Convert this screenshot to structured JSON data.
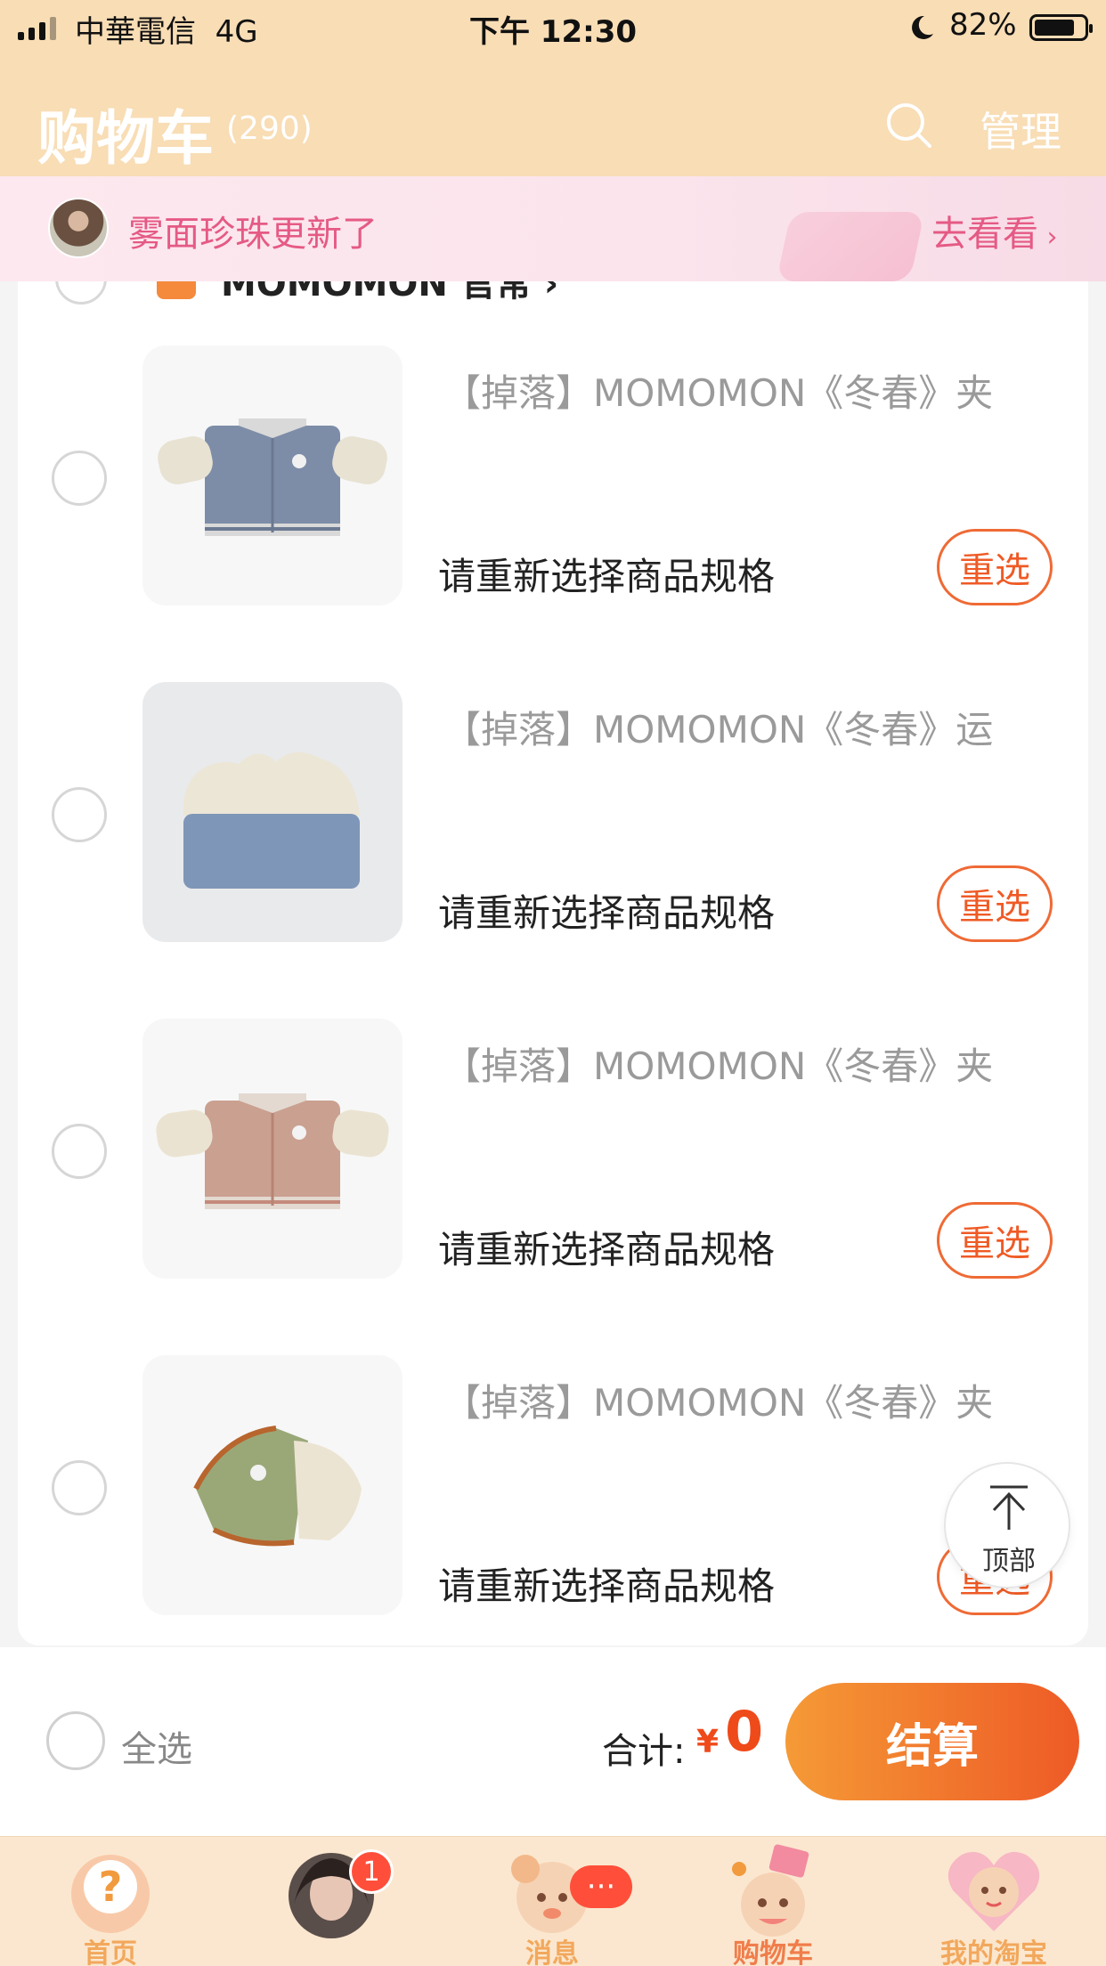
{
  "status_bar": {
    "carrier": "中華電信",
    "network": "4G",
    "time": "下午 12:30",
    "battery_pct": "82%",
    "battery_level": 0.82
  },
  "header": {
    "title": "购物车",
    "count": "(290)",
    "manage_label": "管理",
    "search_icon": "search-icon"
  },
  "banner": {
    "text": "雾面珍珠更新了",
    "link": "去看看"
  },
  "shop_peek": {
    "name": "MOMOMON 官常 ›"
  },
  "items": [
    {
      "name": "【掉落】MOMOMON《冬春》夹",
      "spec": "请重新选择商品规格",
      "action": "重选",
      "thumb": "jacket-blue"
    },
    {
      "name": "【掉落】MOMOMON《冬春》运",
      "spec": "请重新选择商品规格",
      "action": "重选",
      "thumb": "hat-blue"
    },
    {
      "name": "【掉落】MOMOMON《冬春》夹",
      "spec": "请重新选择商品规格",
      "action": "重选",
      "thumb": "jacket-pink"
    },
    {
      "name": "【掉落】MOMOMON《冬春》夹",
      "spec": "请重新选择商品规格",
      "action": "重选",
      "thumb": "jacket-green"
    }
  ],
  "back_to_top": "顶部",
  "footer": {
    "select_all": "全选",
    "total_label": "合计:",
    "currency": "¥",
    "total": "0",
    "checkout": "结算"
  },
  "tabbar": {
    "tabs": [
      {
        "label": "首页",
        "icon": "home-mascot-icon"
      },
      {
        "label": "",
        "icon": "live-avatar-icon",
        "badge": "1"
      },
      {
        "label": "消息",
        "icon": "message-mascot-icon",
        "badge": "···"
      },
      {
        "label": "购物车",
        "icon": "cart-mascot-icon",
        "active": true
      },
      {
        "label": "我的淘宝",
        "icon": "my-taobao-mascot-icon"
      }
    ]
  },
  "colors": {
    "accent": "#ef5a25",
    "header_bg": "#f8ddb5",
    "banner_text": "#e55a85",
    "tab_bg": "#fbe7cf"
  }
}
